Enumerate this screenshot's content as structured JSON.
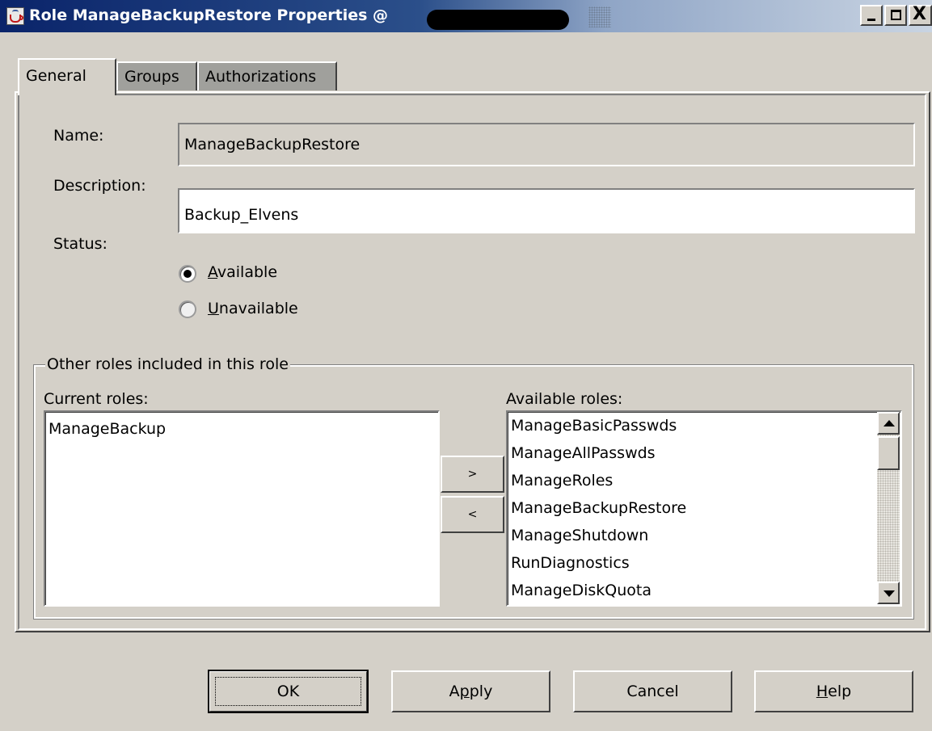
{
  "window": {
    "title": "Role ManageBackupRestore Properties @",
    "minimize_label": "_",
    "close_label": "X"
  },
  "tabs": [
    {
      "label": "General",
      "selected": true
    },
    {
      "label": "Groups",
      "selected": false
    },
    {
      "label": "Authorizations",
      "selected": false
    }
  ],
  "general": {
    "name_label": "Name:",
    "name_value": "ManageBackupRestore",
    "description_label": "Description:",
    "description_value": "Backup_Elvens",
    "status_label": "Status:",
    "status_options": [
      {
        "label_first": "A",
        "label_rest": "vailable",
        "selected": true
      },
      {
        "label_first": "U",
        "label_rest": "navailable",
        "selected": false
      }
    ]
  },
  "roles": {
    "group_title": "Other roles included in this role",
    "current_label": "Current roles:",
    "available_label": "Available roles:",
    "current": [
      "ManageBackup"
    ],
    "available": [
      "ManageBasicPasswds",
      "ManageAllPasswds",
      "ManageRoles",
      "ManageBackupRestore",
      "ManageShutdown",
      "RunDiagnostics",
      "ManageDiskQuota"
    ],
    "add_label": ">",
    "remove_label": "<"
  },
  "buttons": {
    "ok": "OK",
    "apply_first": "A",
    "apply_mnemonic": "p",
    "apply_rest": "ply",
    "cancel": "Cancel",
    "help_mnemonic": "H",
    "help_rest": "elp"
  }
}
